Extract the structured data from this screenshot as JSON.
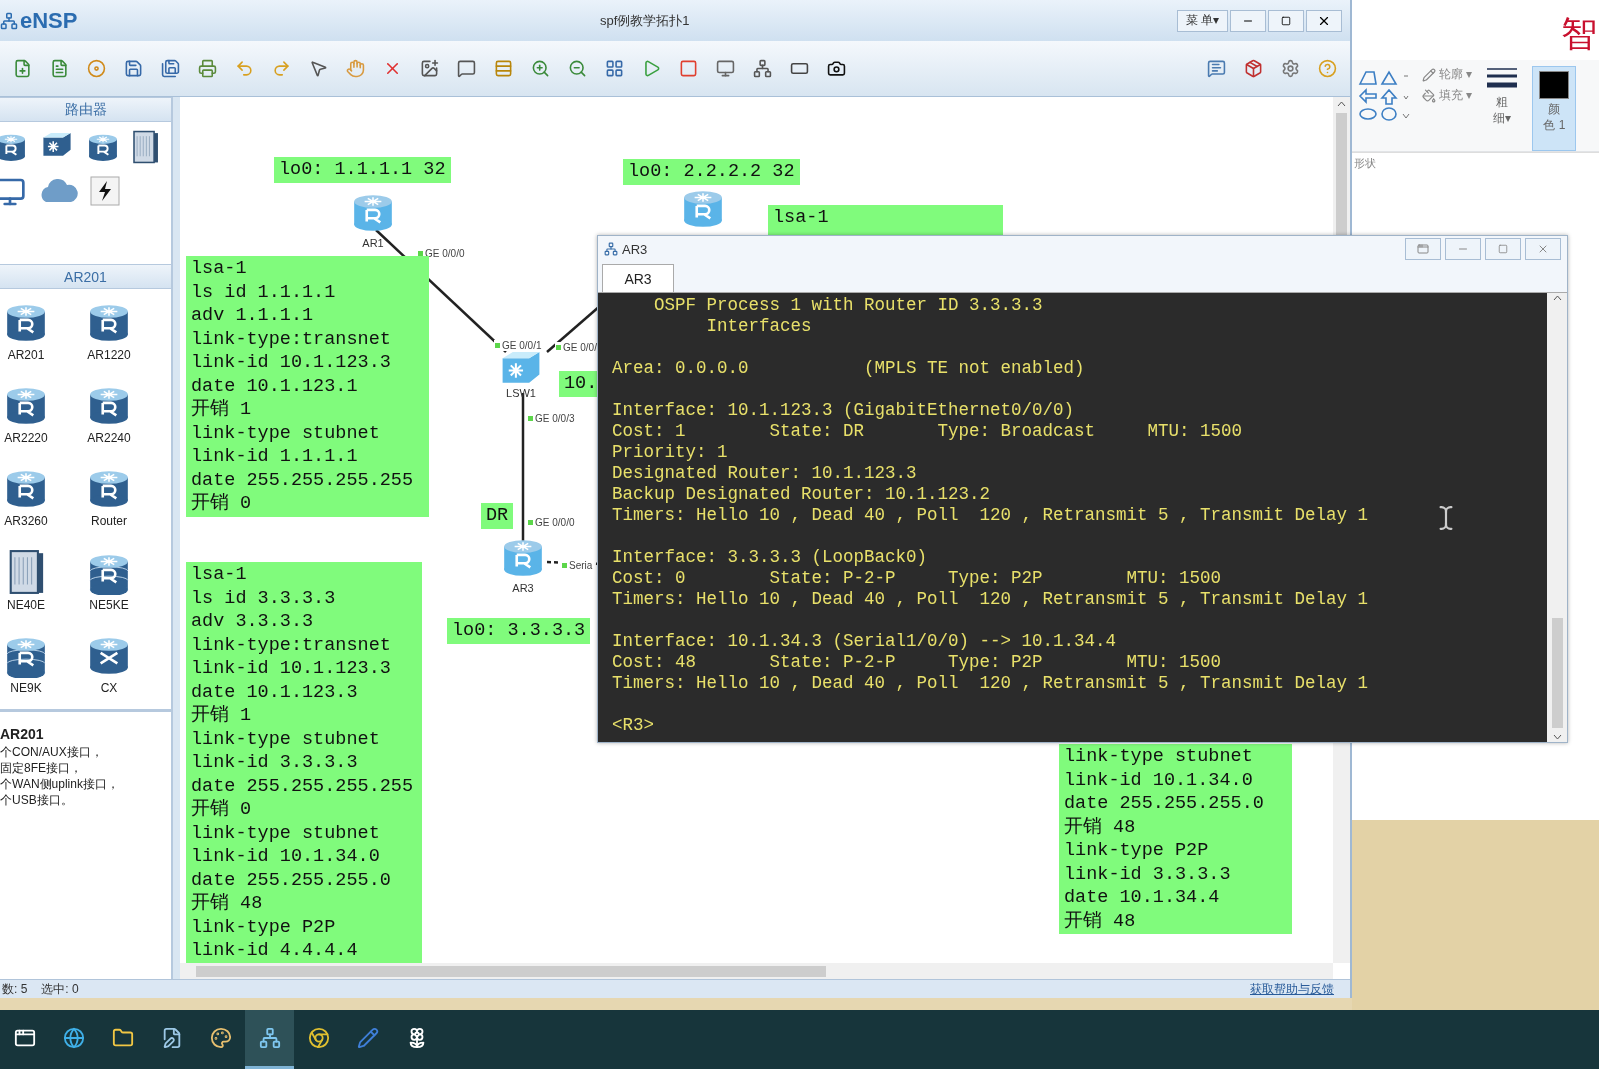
{
  "window": {
    "logo": "eNSP",
    "title": "spf例教学拓扑1",
    "menu_button": "菜 单▾"
  },
  "sidebar": {
    "category_title": "路由器",
    "list_title": "AR201",
    "devices": [
      {
        "label": "AR201",
        "kind": "router"
      },
      {
        "label": "AR1220",
        "kind": "router"
      },
      {
        "label": "AR2220",
        "kind": "router"
      },
      {
        "label": "AR2240",
        "kind": "router"
      },
      {
        "label": "AR3260",
        "kind": "router"
      },
      {
        "label": "Router",
        "kind": "router"
      },
      {
        "label": "NE40E",
        "kind": "chassis"
      },
      {
        "label": "NE5KE",
        "kind": "stack"
      },
      {
        "label": "NE9K",
        "kind": "stack"
      },
      {
        "label": "CX",
        "kind": "cx"
      }
    ],
    "info_title": "AR201",
    "info_lines": [
      "个CON/AUX接口，",
      "固定8FE接口，",
      "个WAN侧uplink接口，",
      "个USB接口。"
    ]
  },
  "canvas": {
    "notes": [
      {
        "lines": [
          "lo0: 1.1.1.1 32"
        ]
      },
      {
        "lines": [
          "lo0: 2.2.2.2 32"
        ]
      },
      {
        "lines": [
          "lsa-1",
          "ls id 1.1.1.1",
          "adv 1.1.1.1",
          "link-type:transnet",
          "link-id 10.1.123.3",
          "date 10.1.123.1",
          "开销 1",
          "link-type stubnet",
          "link-id 1.1.1.1",
          "date 255.255.255.255",
          "开销 0"
        ]
      },
      {
        "lines": [
          "lsa-1"
        ]
      },
      {
        "lines": [
          "lsa-1",
          "ls id 3.3.3.3",
          "adv 3.3.3.3",
          "link-type:transnet",
          "link-id 10.1.123.3",
          "date 10.1.123.3",
          "开销 1",
          "link-type stubnet",
          "link-id 3.3.3.3",
          "date 255.255.255.255",
          "开销 0",
          "link-type stubnet",
          "link-id 10.1.34.0",
          "date 255.255.255.0",
          "开销 48",
          "link-type P2P",
          "link-id 4.4.4.4"
        ]
      },
      {
        "lines": [
          "10."
        ]
      },
      {
        "lines": [
          "DR"
        ]
      },
      {
        "lines": [
          "lo0: 3.3.3.3"
        ]
      },
      {
        "lines": [
          "link-type stubnet",
          "link-id 10.1.34.0",
          "date 255.255.255.0",
          "开销 48",
          "link-type P2P",
          "link-id 3.3.3.3",
          "date 10.1.34.4",
          "开销 48"
        ]
      }
    ],
    "devices": [
      {
        "label": "AR1",
        "kind": "router"
      },
      {
        "kind": "router"
      },
      {
        "label": "LSW1",
        "kind": "switch"
      },
      {
        "label": "AR3",
        "kind": "router"
      }
    ],
    "ports": [
      "GE 0/0/0",
      "GE 0/0/1",
      "GE 0/0/",
      "GE 0/0/3",
      "GE 0/0/0",
      "Seria"
    ]
  },
  "console": {
    "window_title": "AR3",
    "tabs": [
      {
        "label": "AR3",
        "selected": true
      }
    ],
    "groups": [
      [
        "    OSPF Process 1 with Router ID 3.3.3.3",
        "         Interfaces"
      ],
      [
        "Area: 0.0.0.0           (MPLS TE not enabled)"
      ],
      [
        "Interface: 10.1.123.3 (GigabitEthernet0/0/0)",
        "Cost: 1        State: DR       Type: Broadcast     MTU: 1500",
        "Priority: 1",
        "Designated Router: 10.1.123.3",
        "Backup Designated Router: 10.1.123.2",
        "Timers: Hello 10 , Dead 40 , Poll  120 , Retransmit 5 , Transmit Delay 1"
      ],
      [
        "Interface: 3.3.3.3 (LoopBack0)",
        "Cost: 0        State: P-2-P     Type: P2P        MTU: 1500",
        "Timers: Hello 10 , Dead 40 , Poll  120 , Retransmit 5 , Transmit Delay 1"
      ],
      [
        "Interface: 10.1.34.3 (Serial1/0/0) --> 10.1.34.4",
        "Cost: 48       State: P-2-P     Type: P2P        MTU: 1500",
        "Timers: Hello 10 , Dead 40 , Poll  120 , Retransmit 5 , Transmit Delay 1"
      ],
      [
        "<R3>"
      ]
    ]
  },
  "status_bar": {
    "count": "数: 5",
    "selection": "选中: 0",
    "help_link": "获取帮助与反馈"
  },
  "paint_ribbon": {
    "corner_char": "智",
    "outline": "轮廓 ▾",
    "fill": "填充 ▾",
    "size_lines": [
      "粗",
      "细▾"
    ],
    "color_button": {
      "lines": [
        "颜",
        "色 1"
      ],
      "selected": true
    },
    "group_label": "形状"
  },
  "taskbar": {
    "apps": [
      {
        "selected": false
      },
      {
        "selected": false
      },
      {
        "selected": false
      },
      {
        "selected": false
      },
      {
        "selected": false
      },
      {
        "selected": true
      },
      {
        "selected": false
      },
      {
        "selected": false
      },
      {
        "selected": false
      }
    ]
  }
}
